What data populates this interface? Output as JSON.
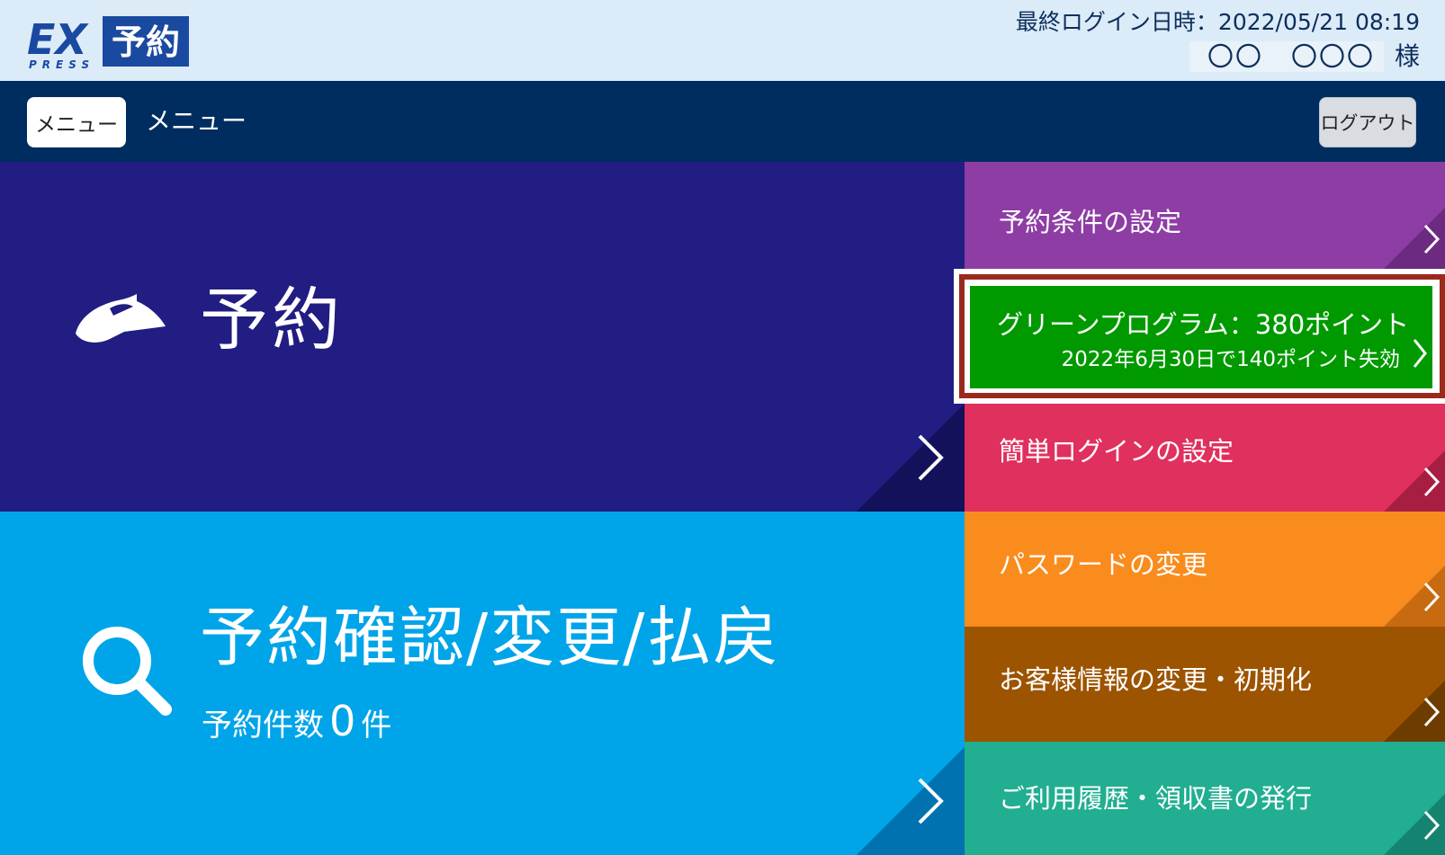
{
  "header": {
    "logo_text_ex": "EX",
    "logo_text_yoyaku": "予約",
    "logo_text_press": "PRESS",
    "last_login": "最終ログイン日時：2022/05/21 08:19",
    "user_name": "〇〇　〇〇〇",
    "user_suffix": "様"
  },
  "navbar": {
    "menu_button_label": "メニュー",
    "title": "メニュー",
    "logout_label": "ログアウト"
  },
  "main": {
    "reserve_label": "予約",
    "confirm_label": "予約確認/変更/払戻",
    "count_prefix": "予約件数",
    "count_value": "0",
    "count_suffix": "件"
  },
  "side_menu": [
    {
      "label": "予約条件の設定",
      "color": "#8e3da5"
    },
    {
      "label": "グリーンプログラム：380ポイント",
      "sub": "2022年6月30日で140ポイント失効",
      "color": "#009a00"
    },
    {
      "label": "簡単ログインの設定",
      "color": "#e0305e"
    },
    {
      "label": "パスワードの変更",
      "color": "#f98c1d"
    },
    {
      "label": "お客様情報の変更・初期化",
      "color": "#9c5400"
    },
    {
      "label": "ご利用履歴・領収書の発行",
      "color": "#21ae91"
    }
  ],
  "icons": {
    "train": "train-icon",
    "search": "search-icon",
    "chevron": "chevron-right-icon"
  },
  "colors": {
    "header_bg": "#dcebf8",
    "navbar_bg": "#002d5f",
    "reserve_bg": "#211d82",
    "confirm_bg": "#00a4e8",
    "highlight_border": "#9a2a1c"
  }
}
